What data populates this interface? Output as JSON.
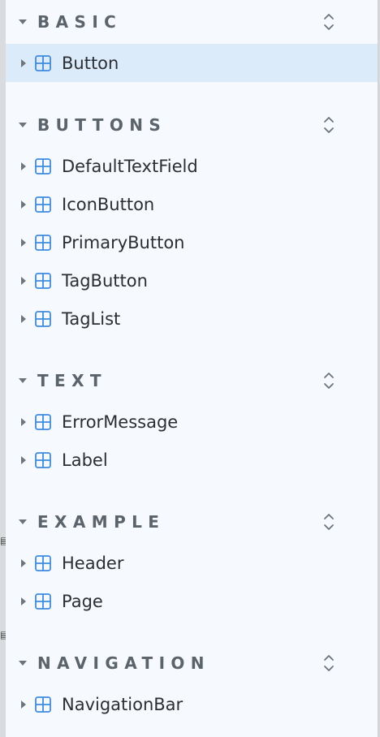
{
  "colors": {
    "sidebar_bg": "#f6f9fd",
    "selected_bg": "#dcebfa",
    "group_title": "#5b636b",
    "item_label": "#2b2f33",
    "component_icon": "#3d8be0"
  },
  "groups": [
    {
      "title": "BASIC",
      "toggle_icon": "chevron-up-down-icon",
      "items": [
        {
          "label": "Button",
          "icon": "component-grid-icon",
          "selected": true
        }
      ]
    },
    {
      "title": "BUTTONS",
      "toggle_icon": "chevron-up-down-icon",
      "items": [
        {
          "label": "DefaultTextField",
          "icon": "component-grid-icon"
        },
        {
          "label": "IconButton",
          "icon": "component-grid-icon"
        },
        {
          "label": "PrimaryButton",
          "icon": "component-grid-icon"
        },
        {
          "label": "TagButton",
          "icon": "component-grid-icon"
        },
        {
          "label": "TagList",
          "icon": "component-grid-icon"
        }
      ]
    },
    {
      "title": "TEXT",
      "toggle_icon": "chevron-up-down-icon",
      "items": [
        {
          "label": "ErrorMessage",
          "icon": "component-grid-icon"
        },
        {
          "label": "Label",
          "icon": "component-grid-icon"
        }
      ]
    },
    {
      "title": "EXAMPLE",
      "toggle_icon": "chevron-up-down-icon",
      "items": [
        {
          "label": "Header",
          "icon": "component-grid-icon"
        },
        {
          "label": "Page",
          "icon": "component-grid-icon"
        }
      ]
    },
    {
      "title": "NAVIGATION",
      "toggle_icon": "chevron-up-down-icon",
      "items": [
        {
          "label": "NavigationBar",
          "icon": "component-grid-icon"
        }
      ]
    }
  ]
}
